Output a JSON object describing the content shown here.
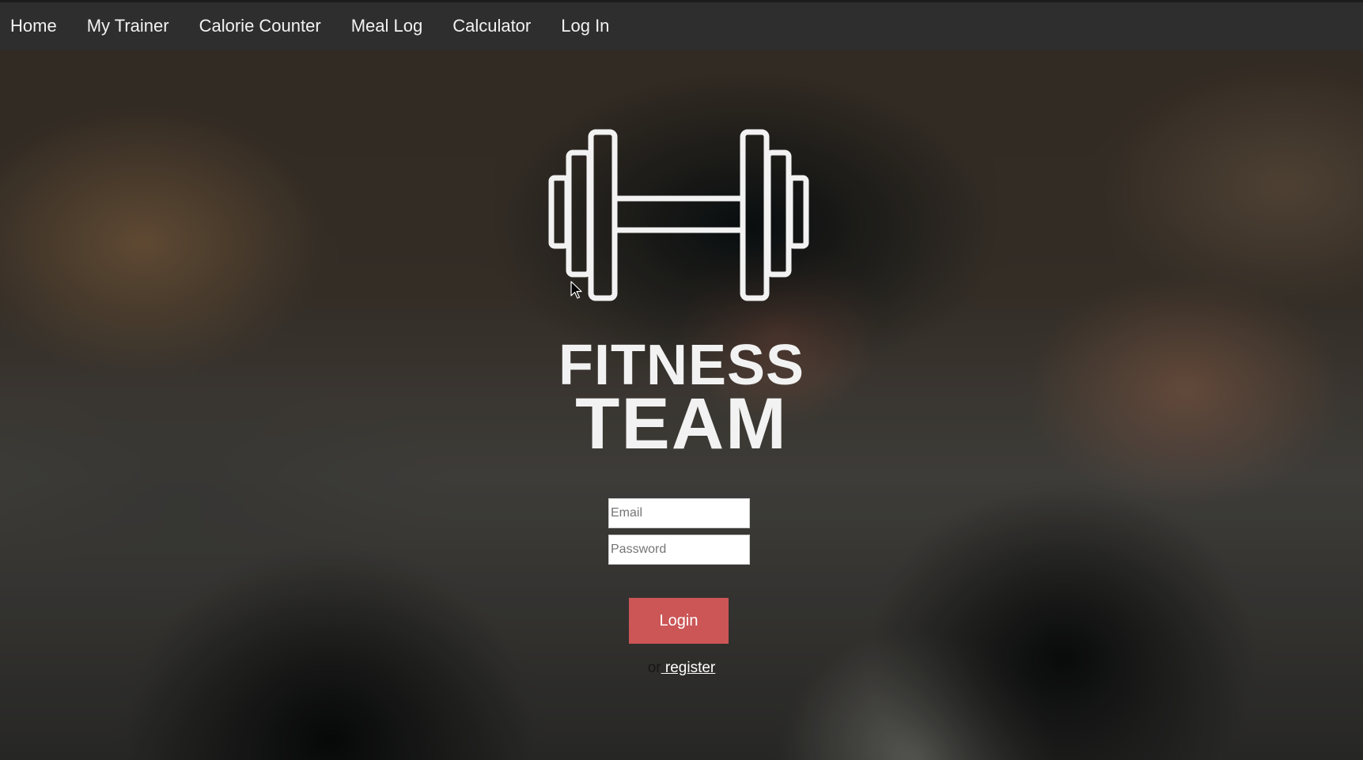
{
  "nav": {
    "items": [
      {
        "label": "Home"
      },
      {
        "label": "My Trainer"
      },
      {
        "label": "Calorie Counter"
      },
      {
        "label": "Meal Log"
      },
      {
        "label": "Calculator"
      },
      {
        "label": "Log In"
      }
    ]
  },
  "brand": {
    "line1": "FITNESS",
    "line2": "TEAM",
    "logo_icon": "dumbbell-icon"
  },
  "form": {
    "email_placeholder": "Email",
    "email_value": "",
    "password_placeholder": "Password",
    "password_value": "",
    "login_label": "Login",
    "or_text": "or",
    "register_label": " register"
  },
  "colors": {
    "navbar_bg": "#2e2e2e",
    "login_button_bg": "#cc5556",
    "brand_text": "#f2f2f2"
  }
}
